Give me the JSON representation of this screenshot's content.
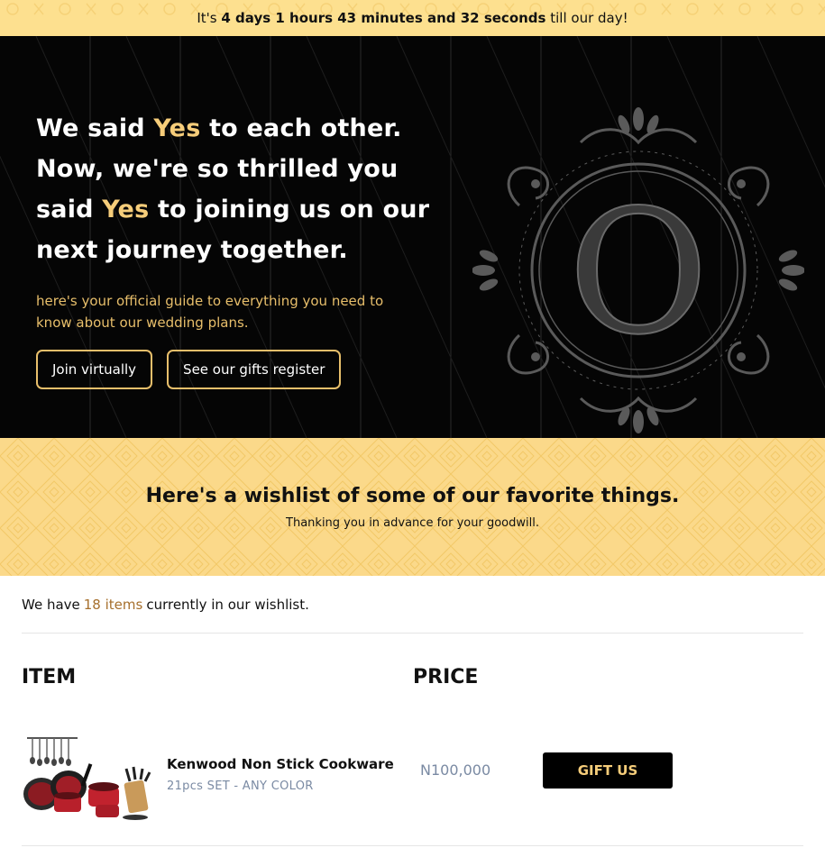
{
  "countdown": {
    "prefix": "It's",
    "time": "4 days 1 hours 43 minutes and 32 seconds",
    "suffix": "till our day!"
  },
  "hero": {
    "line1_a": "We said ",
    "line1_yes": "Yes",
    "line1_b": " to each other.",
    "line2": "Now, we're so thrilled you",
    "line3_a": "said ",
    "line3_yes": "Yes",
    "line3_b": " to joining us on our",
    "line4": "next journey together.",
    "subtitle": "here's your official guide to everything you need to know about our wedding plans.",
    "buttons": {
      "join": "Join virtually",
      "gifts": "See our gifts register"
    },
    "monogram_letter": "O"
  },
  "banner": {
    "title": "Here's a wishlist of some of our favorite things.",
    "subtitle": "Thanking you in advance for your goodwill."
  },
  "wishlist": {
    "count_prefix": "We have",
    "count_highlight": "18 items",
    "count_suffix": "currently in our wishlist.",
    "headers": {
      "item": "ITEM",
      "price": "PRICE"
    },
    "items": [
      {
        "name": "Kenwood Non Stick Cookware",
        "variant": "21pcs SET - ANY COLOR",
        "price": "N100,000",
        "action": "GIFT US"
      }
    ]
  },
  "colors": {
    "gold": "#f6cd7a",
    "gold_muted": "#e8bf6b",
    "banner_yellow": "#fbd98a",
    "price_gray": "#7a8aa3"
  }
}
